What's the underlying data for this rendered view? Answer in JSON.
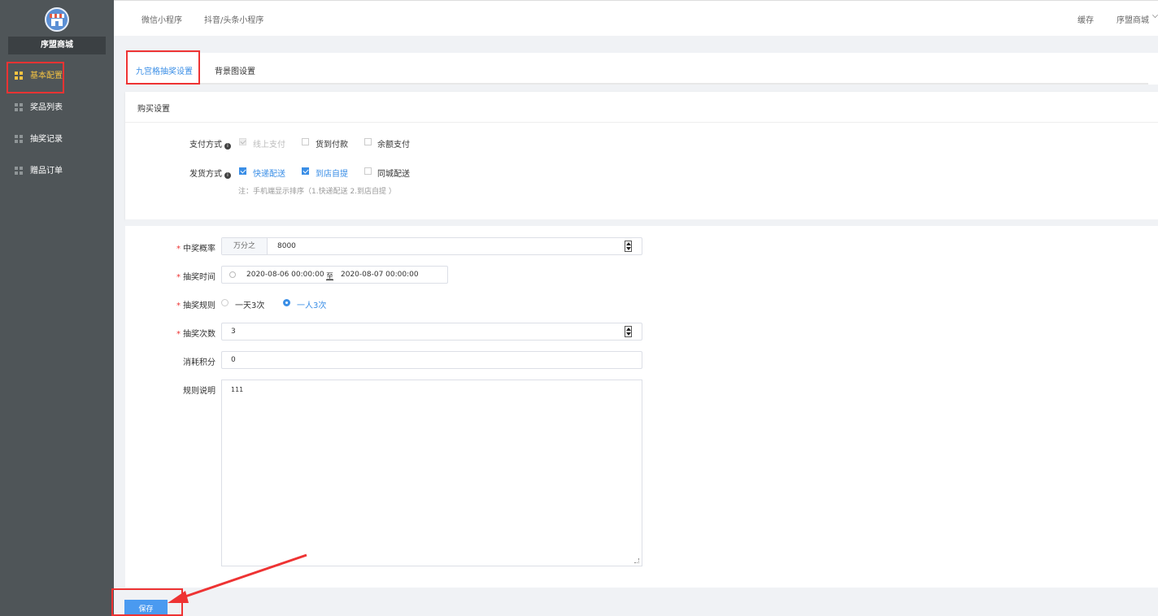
{
  "sidebar": {
    "shop_name": "序盟商城",
    "items": [
      {
        "label": "基本配置",
        "active": true
      },
      {
        "label": "奖品列表",
        "active": false
      },
      {
        "label": "抽奖记录",
        "active": false
      },
      {
        "label": "赠品订单",
        "active": false
      }
    ]
  },
  "topbar": {
    "links": [
      "微信小程序",
      "抖音/头条小程序"
    ],
    "cache": "缓存",
    "user": "序盟商城"
  },
  "tabs": [
    {
      "label": "九宫格抽奖设置",
      "active": true
    },
    {
      "label": "背景图设置",
      "active": false
    }
  ],
  "purchase": {
    "title": "购买设置",
    "payment_label": "支付方式",
    "payment_options": [
      {
        "label": "线上支付",
        "checked": true,
        "disabled": true
      },
      {
        "label": "货到付款",
        "checked": false,
        "disabled": false
      },
      {
        "label": "余额支付",
        "checked": false,
        "disabled": false
      }
    ],
    "delivery_label": "发货方式",
    "delivery_options": [
      {
        "label": "快递配送",
        "checked": true
      },
      {
        "label": "到店自提",
        "checked": true
      },
      {
        "label": "同城配送",
        "checked": false
      }
    ],
    "note": "注：手机端显示排序（1.快递配送 2.到店自提 ）"
  },
  "form": {
    "win_rate_label": "中奖概率",
    "win_rate_prefix": "万分之",
    "win_rate_value": "8000",
    "time_label": "抽奖时间",
    "time_start": "2020-08-06 00:00:00",
    "time_sep": "至",
    "time_end": "2020-08-07 00:00:00",
    "rule_label": "抽奖规则",
    "rule_options": [
      {
        "label": "一天3次",
        "selected": false
      },
      {
        "label": "一人3次",
        "selected": true
      }
    ],
    "count_label": "抽奖次数",
    "count_value": "3",
    "points_label": "消耗积分",
    "points_value": "0",
    "desc_label": "规则说明",
    "desc_value": "111"
  },
  "save_label": "保存",
  "colors": {
    "accent": "#3a8ee6",
    "highlight": "#e33333",
    "sidebar_bg": "#4f5558",
    "active_menu": "#f5c342"
  }
}
